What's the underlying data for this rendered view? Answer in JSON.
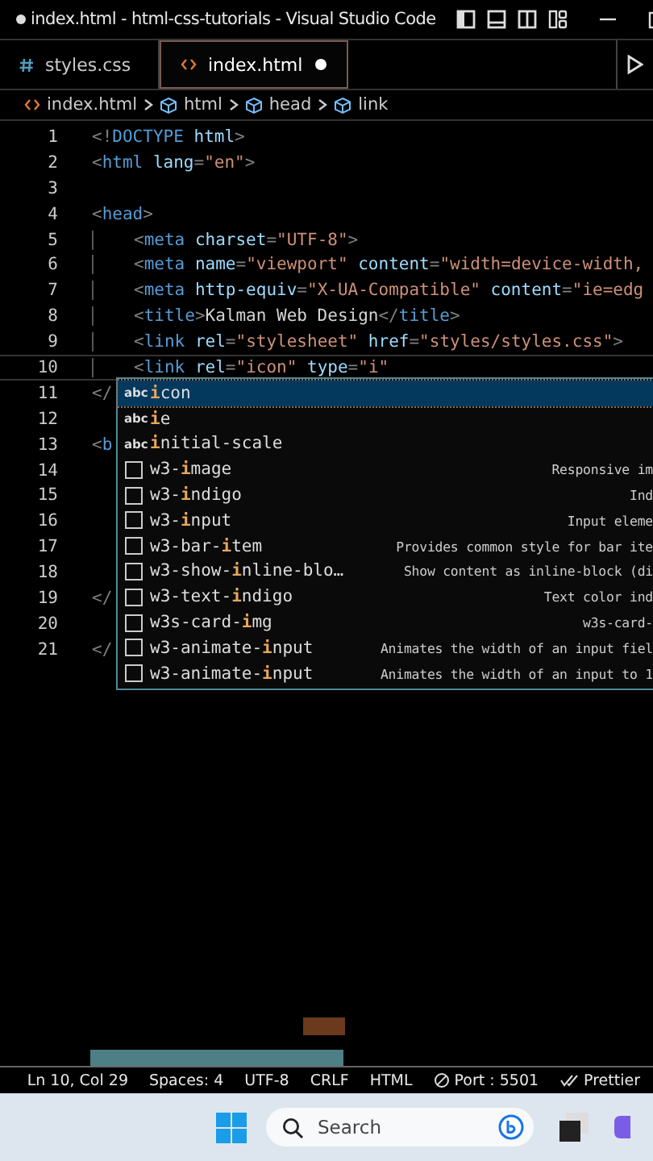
{
  "window": {
    "title": "index.html - html-css-tutorials - Visual Studio Code",
    "modified": true
  },
  "tabs": [
    {
      "label": "styles.css",
      "kind": "css",
      "selected": false,
      "modified": false
    },
    {
      "label": "index.html",
      "kind": "html",
      "selected": true,
      "modified": true
    }
  ],
  "breadcrumb": [
    {
      "label": "index.html",
      "kind": "file"
    },
    {
      "label": "html",
      "kind": "element"
    },
    {
      "label": "head",
      "kind": "element"
    },
    {
      "label": "link",
      "kind": "element"
    }
  ],
  "editor": {
    "lines": [
      {
        "number": "1",
        "current": false,
        "tokens": [
          {
            "kind": "punct",
            "text": "<!"
          },
          {
            "kind": "tag",
            "text": "DOCTYPE"
          },
          {
            "kind": "attr",
            "text": " html"
          },
          {
            "kind": "punct",
            "text": ">"
          }
        ]
      },
      {
        "number": "2",
        "current": false,
        "tokens": [
          {
            "kind": "punct",
            "text": "<"
          },
          {
            "kind": "tag",
            "text": "html"
          },
          {
            "kind": "attr",
            "text": " lang"
          },
          {
            "kind": "punct",
            "text": "="
          },
          {
            "kind": "string",
            "text": "\"en\""
          },
          {
            "kind": "punct",
            "text": ">"
          }
        ]
      },
      {
        "number": "3",
        "current": false
      },
      {
        "number": "4",
        "current": false,
        "tokens": [
          {
            "kind": "punct",
            "text": "<"
          },
          {
            "kind": "tag",
            "text": "head"
          },
          {
            "kind": "punct",
            "text": ">"
          }
        ],
        "children": [
          {
            "number": "5",
            "current": false,
            "tokens": [
              {
                "kind": "punct",
                "text": "<"
              },
              {
                "kind": "tag",
                "text": "meta"
              },
              {
                "kind": "attr",
                "text": " charset"
              },
              {
                "kind": "punct",
                "text": "="
              },
              {
                "kind": "string",
                "text": "\"UTF-8\""
              },
              {
                "kind": "punct",
                "text": ">"
              }
            ]
          },
          {
            "number": "6",
            "current": false,
            "tokens": [
              {
                "kind": "punct",
                "text": "<"
              },
              {
                "kind": "tag",
                "text": "meta"
              },
              {
                "kind": "attr",
                "text": " name"
              },
              {
                "kind": "punct",
                "text": "="
              },
              {
                "kind": "string",
                "text": "\"viewport\""
              },
              {
                "kind": "attr",
                "text": " content"
              },
              {
                "kind": "punct",
                "text": "="
              },
              {
                "kind": "string",
                "text": "\"width=device-width,"
              }
            ]
          },
          {
            "number": "7",
            "current": false,
            "tokens": [
              {
                "kind": "punct",
                "text": "<"
              },
              {
                "kind": "tag",
                "text": "meta"
              },
              {
                "kind": "attr",
                "text": " http-equiv"
              },
              {
                "kind": "punct",
                "text": "="
              },
              {
                "kind": "string",
                "text": "\"X-UA-Compatible\""
              },
              {
                "kind": "attr",
                "text": " content"
              },
              {
                "kind": "punct",
                "text": "="
              },
              {
                "kind": "string",
                "text": "\"ie=edg"
              }
            ]
          },
          {
            "number": "8",
            "current": false,
            "tokens": [
              {
                "kind": "punct",
                "text": "<"
              },
              {
                "kind": "tag",
                "text": "title"
              },
              {
                "kind": "punct",
                "text": ">"
              },
              {
                "kind": "text",
                "text": "Kalman Web Design"
              },
              {
                "kind": "punct",
                "text": "</"
              },
              {
                "kind": "tag",
                "text": "title"
              },
              {
                "kind": "punct",
                "text": ">"
              }
            ]
          },
          {
            "number": "9",
            "current": false,
            "tokens": [
              {
                "kind": "punct",
                "text": "<"
              },
              {
                "kind": "tag",
                "text": "link"
              },
              {
                "kind": "attr",
                "text": " rel"
              },
              {
                "kind": "punct",
                "text": "="
              },
              {
                "kind": "string",
                "text": "\"stylesheet\""
              },
              {
                "kind": "attr",
                "text": " href"
              },
              {
                "kind": "punct",
                "text": "="
              },
              {
                "kind": "string",
                "text": "\"styles/styles.css\""
              },
              {
                "kind": "punct",
                "text": ">"
              }
            ]
          },
          {
            "number": "10",
            "current": true,
            "tokens": [
              {
                "kind": "punct",
                "text": "<"
              },
              {
                "kind": "tag",
                "text": "link"
              },
              {
                "kind": "attr",
                "text": " rel"
              },
              {
                "kind": "punct",
                "text": "="
              },
              {
                "kind": "string",
                "text": "\"icon\""
              },
              {
                "kind": "attr",
                "text": " type"
              },
              {
                "kind": "punct",
                "text": "="
              },
              {
                "kind": "string",
                "text": "\"i\""
              }
            ]
          }
        ]
      },
      {
        "number": "11",
        "current": false,
        "tokens": [
          {
            "kind": "punct",
            "text": "</"
          }
        ]
      },
      {
        "number": "12",
        "current": false
      },
      {
        "number": "13",
        "current": false,
        "tokens": [
          {
            "kind": "punct",
            "text": "<"
          },
          {
            "kind": "tag",
            "text": "b"
          }
        ]
      },
      {
        "number": "14",
        "current": false
      },
      {
        "number": "15",
        "current": false
      },
      {
        "number": "16",
        "current": false
      },
      {
        "number": "17",
        "current": false
      },
      {
        "number": "18",
        "current": false
      },
      {
        "number": "19",
        "current": false,
        "tokens": [
          {
            "kind": "punct",
            "text": "</"
          }
        ]
      },
      {
        "number": "20",
        "current": false
      },
      {
        "number": "21",
        "current": false,
        "tokens": [
          {
            "kind": "punct",
            "text": "</"
          }
        ]
      }
    ]
  },
  "suggestions": [
    {
      "kind": "text",
      "icon": "abc",
      "label": "**i**con",
      "selected": true
    },
    {
      "kind": "text",
      "icon": "abc",
      "label": "**i**e",
      "selected": false
    },
    {
      "kind": "text",
      "icon": "abc",
      "label": "**i**nitial-scale",
      "selected": false
    },
    {
      "kind": "class",
      "label": "w3-**i**mage",
      "detail": "Responsive im",
      "selected": false
    },
    {
      "kind": "class",
      "label": "w3-**i**ndigo",
      "detail": "Ind",
      "selected": false
    },
    {
      "kind": "class",
      "label": "w3-**i**nput",
      "detail": "Input eleme",
      "selected": false
    },
    {
      "kind": "class",
      "label": "w3-bar-**i**tem",
      "detail": "Provides common style for bar ite",
      "selected": false
    },
    {
      "kind": "class",
      "label": "w3-show-**i**nline-blo…",
      "detail": "Show content as inline-block (di",
      "selected": false
    },
    {
      "kind": "class",
      "label": "w3-text-**i**ndigo",
      "detail": "Text color ind",
      "selected": false
    },
    {
      "kind": "class",
      "label": "w3s-card-**i**mg",
      "detail": "w3s-card-",
      "selected": false
    },
    {
      "kind": "class",
      "label": "w3-animate-**i**nput",
      "detail": "Animates the width of an input fiel",
      "selected": false
    },
    {
      "kind": "class",
      "label": "w3-animate-**i**nput",
      "detail": "Animates the width of an input to 1",
      "selected": false
    }
  ],
  "status_bar": [
    {
      "label": "Ln 10, Col 29",
      "kind": "plain"
    },
    {
      "label": "Spaces: 4",
      "kind": "plain"
    },
    {
      "label": "UTF-8",
      "kind": "plain"
    },
    {
      "label": "CRLF",
      "kind": "plain"
    },
    {
      "label": "HTML",
      "kind": "plain"
    },
    {
      "label": "Port : 5501",
      "kind": "port"
    },
    {
      "label": "Prettier",
      "kind": "check"
    }
  ],
  "taskbar": {
    "search_placeholder": "Search"
  }
}
